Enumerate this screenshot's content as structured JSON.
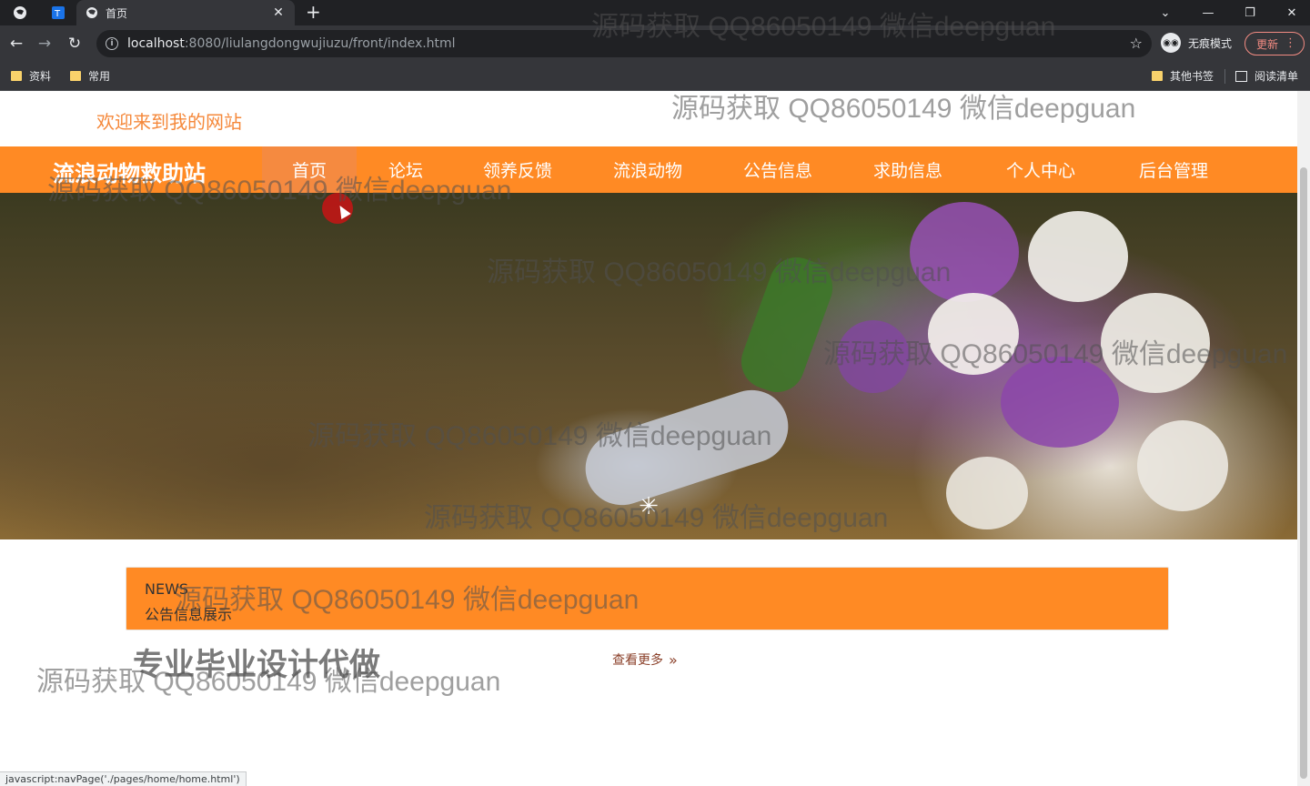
{
  "browser": {
    "tab_title": "首页",
    "url_host": "localhost",
    "url_rest": ":8080/liulangdongwujiuzu/front/index.html",
    "incognito_label": "无痕模式",
    "update_label": "更新",
    "bookmarks": [
      "资料",
      "常用"
    ],
    "bookmarks_right": [
      "其他书签",
      "阅读清单"
    ],
    "status_text": "javascript:navPage('./pages/home/home.html')"
  },
  "site": {
    "welcome": "欢迎来到我的网站",
    "brand": "流浪动物救助站",
    "nav": [
      "首页",
      "论坛",
      "领养反馈",
      "流浪动物",
      "公告信息",
      "求助信息",
      "个人中心",
      "后台管理"
    ],
    "active_nav": "首页",
    "accent_color": "#ff8a24"
  },
  "news": {
    "label_en": "NEWS",
    "label_cn": "公告信息展示"
  },
  "section": {
    "title": "专业毕业设计代做",
    "more": "查看更多"
  },
  "watermark": "源码获取 QQ86050149 微信deepguan"
}
